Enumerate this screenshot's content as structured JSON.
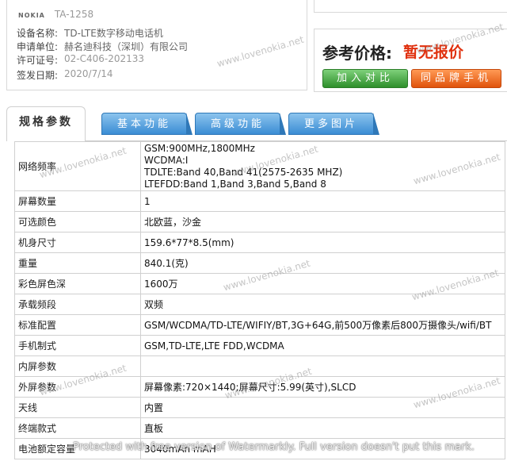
{
  "device": {
    "brand": "NOKIA",
    "model": "TA-1258",
    "rows": [
      {
        "label": "设备名称:",
        "value": "TD-LTE数字移动电话机"
      },
      {
        "label": "申请单位:",
        "value": "赫名迪科技（深圳）有限公司"
      },
      {
        "label": "许可证号:",
        "value": "02-C406-202133"
      },
      {
        "label": "签发日期:",
        "value": "2020/7/14"
      }
    ]
  },
  "price": {
    "label": "参考价格:",
    "value": "暂无报价",
    "compare_button": "加入对比",
    "same_brand_button": "同品牌手机"
  },
  "tabs": [
    "规格参数",
    "基本功能",
    "高级功能",
    "更多图片"
  ],
  "specs": [
    {
      "key": "网络频率",
      "lines": [
        "GSM:900MHz,1800MHz",
        "WCDMA:I",
        "TDLTE:Band 40,Band 41(2575-2635 MHZ)",
        "LTEFDD:Band 1,Band 3,Band 5,Band 8"
      ]
    },
    {
      "key": "屏幕数量",
      "value": "1"
    },
    {
      "key": "可选颜色",
      "value": "北欧蓝，沙金"
    },
    {
      "key": "机身尺寸",
      "value": "159.6*77*8.5(mm)"
    },
    {
      "key": "重量",
      "value": "840.1(克)"
    },
    {
      "key": "彩色屏色深",
      "value": "1600万"
    },
    {
      "key": "承载频段",
      "value": "双频"
    },
    {
      "key": "标准配置",
      "value": "GSM/WCDMA/TD-LTE/WIFIY/BT,3G+64G,前500万像素后800万摄像头/wifi/BT"
    },
    {
      "key": "手机制式",
      "value": "GSM,TD-LTE,LTE FDD,WCDMA"
    },
    {
      "key": "内屏参数",
      "value": ""
    },
    {
      "key": "外屏参数",
      "value": "屏幕像素:720×1440;屏幕尺寸:5.99(英寸),SLCD"
    },
    {
      "key": "天线",
      "value": "内置"
    },
    {
      "key": "终端款式",
      "value": "直板"
    },
    {
      "key": "电池额定容量",
      "value": "3040mAh mAH"
    }
  ],
  "watermark": "www.lovenokia.net",
  "bottom_watermark": "Protected with free version of Watermarkly. Full version doesn't put this mark."
}
